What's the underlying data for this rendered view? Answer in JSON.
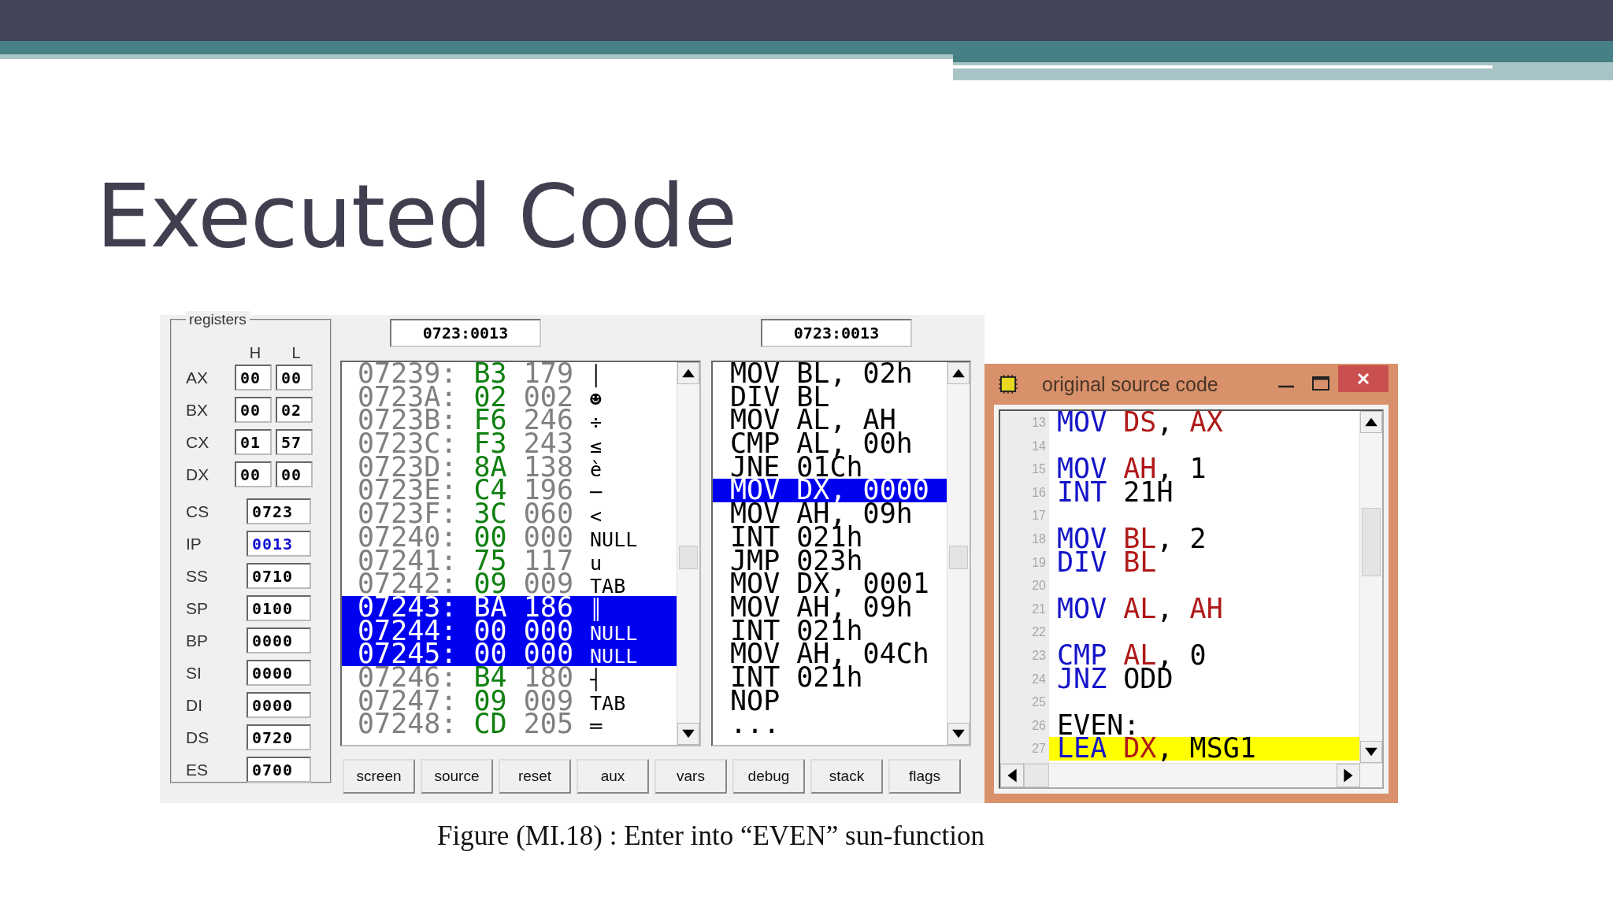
{
  "slide": {
    "title": "Executed Code",
    "caption": "Figure (MI.18) : Enter into “EVEN” sun-function"
  },
  "emulator": {
    "registers": {
      "title": "registers",
      "col_h": "H",
      "col_l": "L",
      "split": [
        {
          "name": "AX",
          "h": "00",
          "l": "00"
        },
        {
          "name": "BX",
          "h": "00",
          "l": "02"
        },
        {
          "name": "CX",
          "h": "01",
          "l": "57"
        },
        {
          "name": "DX",
          "h": "00",
          "l": "00"
        }
      ],
      "full": [
        {
          "name": "CS",
          "value": "0723",
          "highlighted": false
        },
        {
          "name": "IP",
          "value": "0013",
          "highlighted": true
        },
        {
          "name": "SS",
          "value": "0710",
          "highlighted": false
        },
        {
          "name": "SP",
          "value": "0100",
          "highlighted": false
        },
        {
          "name": "BP",
          "value": "0000",
          "highlighted": false
        },
        {
          "name": "SI",
          "value": "0000",
          "highlighted": false
        },
        {
          "name": "DI",
          "value": "0000",
          "highlighted": false
        },
        {
          "name": "DS",
          "value": "0720",
          "highlighted": false
        },
        {
          "name": "ES",
          "value": "0700",
          "highlighted": false
        }
      ]
    },
    "memory": {
      "address": "0723:0013",
      "rows": [
        {
          "address": "07239:",
          "hex": "B3",
          "dec": "179",
          "char": "│",
          "selected": false
        },
        {
          "address": "0723A:",
          "hex": "02",
          "dec": "002",
          "char": "☻",
          "selected": false
        },
        {
          "address": "0723B:",
          "hex": "F6",
          "dec": "246",
          "char": "÷",
          "selected": false
        },
        {
          "address": "0723C:",
          "hex": "F3",
          "dec": "243",
          "char": "≤",
          "selected": false
        },
        {
          "address": "0723D:",
          "hex": "8A",
          "dec": "138",
          "char": "è",
          "selected": false
        },
        {
          "address": "0723E:",
          "hex": "C4",
          "dec": "196",
          "char": "─",
          "selected": false
        },
        {
          "address": "0723F:",
          "hex": "3C",
          "dec": "060",
          "char": "<",
          "selected": false
        },
        {
          "address": "07240:",
          "hex": "00",
          "dec": "000",
          "char": "NULL",
          "selected": false
        },
        {
          "address": "07241:",
          "hex": "75",
          "dec": "117",
          "char": "u",
          "selected": false
        },
        {
          "address": "07242:",
          "hex": "09",
          "dec": "009",
          "char": "TAB",
          "selected": false
        },
        {
          "address": "07243:",
          "hex": "BA",
          "dec": "186",
          "char": "║",
          "selected": true
        },
        {
          "address": "07244:",
          "hex": "00",
          "dec": "000",
          "char": "NULL",
          "selected": true
        },
        {
          "address": "07245:",
          "hex": "00",
          "dec": "000",
          "char": "NULL",
          "selected": true
        },
        {
          "address": "07246:",
          "hex": "B4",
          "dec": "180",
          "char": "┤",
          "selected": false
        },
        {
          "address": "07247:",
          "hex": "09",
          "dec": "009",
          "char": "TAB",
          "selected": false
        },
        {
          "address": "07248:",
          "hex": "CD",
          "dec": "205",
          "char": "═",
          "selected": false
        }
      ]
    },
    "disassembly": {
      "address": "0723:0013",
      "lines": [
        {
          "text": "MOV BL, 02h",
          "selected": false
        },
        {
          "text": "DIV BL",
          "selected": false
        },
        {
          "text": "MOV AL, AH",
          "selected": false
        },
        {
          "text": "CMP AL, 00h",
          "selected": false
        },
        {
          "text": "JNE 01Ch",
          "selected": false
        },
        {
          "text": "MOV DX, 0000",
          "selected": true
        },
        {
          "text": "MOV AH, 09h",
          "selected": false
        },
        {
          "text": "INT 021h",
          "selected": false
        },
        {
          "text": "JMP 023h",
          "selected": false
        },
        {
          "text": "MOV DX, 0001",
          "selected": false
        },
        {
          "text": "MOV AH, 09h",
          "selected": false
        },
        {
          "text": "INT 021h",
          "selected": false
        },
        {
          "text": "MOV AH, 04Ch",
          "selected": false
        },
        {
          "text": "INT 021h",
          "selected": false
        },
        {
          "text": "NOP",
          "selected": false
        },
        {
          "text": "...",
          "selected": false
        }
      ]
    },
    "buttons": [
      "screen",
      "source",
      "reset",
      "aux",
      "vars",
      "debug",
      "stack",
      "flags"
    ]
  },
  "source_window": {
    "title": "original source code",
    "lines": [
      {
        "number": "13",
        "highlighted": false,
        "tokens": [
          {
            "text": "MOV ",
            "kind": "keyword"
          },
          {
            "text": "DS",
            "kind": "register"
          },
          {
            "text": ", ",
            "kind": "plain"
          },
          {
            "text": "AX",
            "kind": "register"
          }
        ]
      },
      {
        "number": "14",
        "highlighted": false
      },
      {
        "number": "15",
        "highlighted": false,
        "tokens": [
          {
            "text": "MOV ",
            "kind": "keyword"
          },
          {
            "text": "AH",
            "kind": "register"
          },
          {
            "text": ", 1",
            "kind": "plain"
          }
        ]
      },
      {
        "number": "16",
        "highlighted": false,
        "tokens": [
          {
            "text": "INT ",
            "kind": "keyword"
          },
          {
            "text": "21H",
            "kind": "plain"
          }
        ]
      },
      {
        "number": "17",
        "highlighted": false
      },
      {
        "number": "18",
        "highlighted": false,
        "tokens": [
          {
            "text": "MOV ",
            "kind": "keyword"
          },
          {
            "text": "BL",
            "kind": "register"
          },
          {
            "text": ", 2",
            "kind": "plain"
          }
        ]
      },
      {
        "number": "19",
        "highlighted": false,
        "tokens": [
          {
            "text": "DIV ",
            "kind": "keyword"
          },
          {
            "text": "BL",
            "kind": "register"
          }
        ]
      },
      {
        "number": "20",
        "highlighted": false
      },
      {
        "number": "21",
        "highlighted": false,
        "tokens": [
          {
            "text": "MOV ",
            "kind": "keyword"
          },
          {
            "text": "AL",
            "kind": "register"
          },
          {
            "text": ", ",
            "kind": "plain"
          },
          {
            "text": "AH",
            "kind": "register"
          }
        ]
      },
      {
        "number": "22",
        "highlighted": false
      },
      {
        "number": "23",
        "highlighted": false,
        "tokens": [
          {
            "text": "CMP ",
            "kind": "keyword"
          },
          {
            "text": "AL",
            "kind": "register"
          },
          {
            "text": ", 0",
            "kind": "plain"
          }
        ]
      },
      {
        "number": "24",
        "highlighted": false,
        "tokens": [
          {
            "text": "JNZ ",
            "kind": "keyword"
          },
          {
            "text": "ODD",
            "kind": "plain"
          }
        ]
      },
      {
        "number": "25",
        "highlighted": false
      },
      {
        "number": "26",
        "highlighted": false,
        "tokens": [
          {
            "text": "EVEN:",
            "kind": "plain"
          }
        ]
      },
      {
        "number": "27",
        "highlighted": true,
        "tokens": [
          {
            "text": "LEA ",
            "kind": "keyword"
          },
          {
            "text": "DX",
            "kind": "register"
          },
          {
            "text": ", MSG1",
            "kind": "plain"
          }
        ]
      }
    ]
  }
}
